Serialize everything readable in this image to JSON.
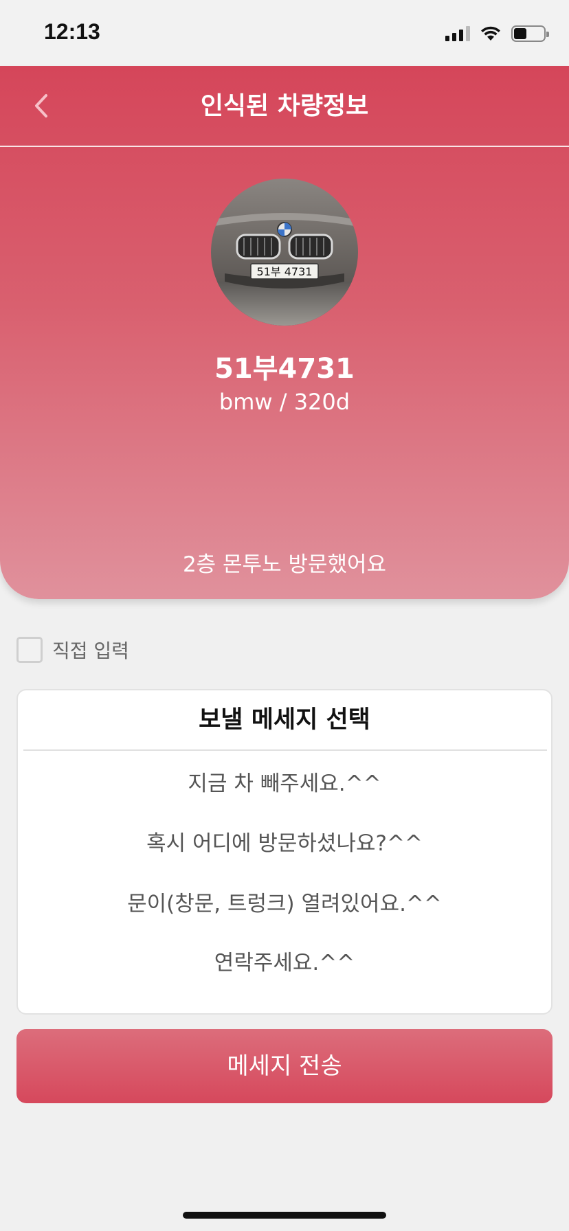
{
  "status_bar": {
    "time": "12:13"
  },
  "header": {
    "title": "인식된 차량정보",
    "back_icon": "chevron-left-icon"
  },
  "vehicle": {
    "plate_number": "51부4731",
    "model": "bmw / 320d",
    "photo_plate_text": "51부 4731",
    "visit_message": "2층 몬투노 방문했어요"
  },
  "direct_input": {
    "label": "직접 입력",
    "checked": false
  },
  "message_select": {
    "title": "보낼 메세지 선택",
    "options": [
      "지금 차 빼주세요.^^",
      "혹시 어디에 방문하셨나요?^^",
      "문이(창문, 트렁크) 열려있어요.^^",
      "연락주세요.^^"
    ]
  },
  "send_button": {
    "label": "메세지 전송"
  },
  "colors": {
    "accent": "#d6485c",
    "background": "#f0f0f0"
  }
}
